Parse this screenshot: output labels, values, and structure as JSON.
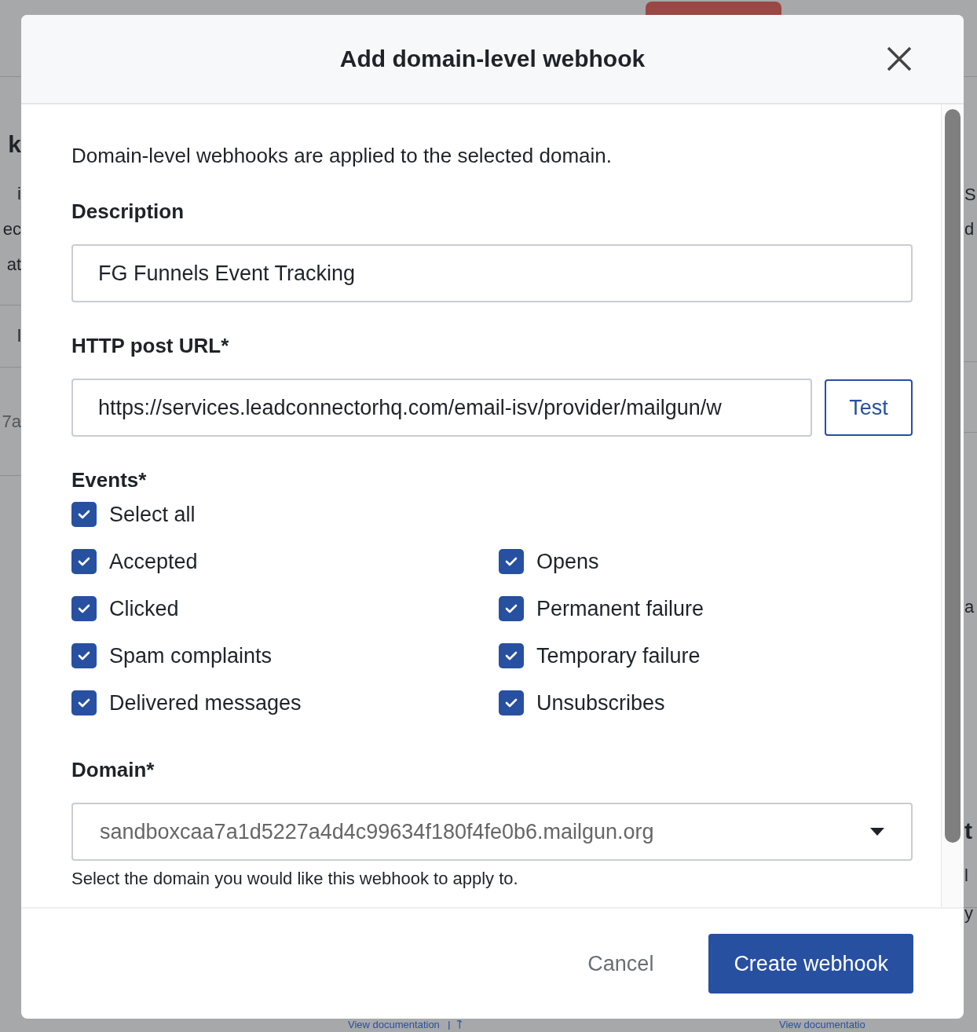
{
  "backdrop": {
    "left_fragments": [
      {
        "text": "k",
        "kind": "heading"
      },
      {
        "text": "i",
        "kind": "text"
      },
      {
        "text": "ec",
        "kind": "text"
      },
      {
        "text": "at",
        "kind": "text"
      },
      {
        "text": "l",
        "kind": "text"
      },
      {
        "text": "7a",
        "kind": "muted"
      }
    ],
    "right_fragments": [
      {
        "text": "S",
        "kind": "text"
      },
      {
        "text": "d",
        "kind": "text"
      },
      {
        "text": "a",
        "kind": "text"
      },
      {
        "text": "t",
        "kind": "heading"
      },
      {
        "text": "l",
        "kind": "text"
      },
      {
        "text": "y",
        "kind": "text"
      }
    ],
    "links": [
      "View documentation",
      "View documentatio"
    ]
  },
  "dialog": {
    "title": "Add domain-level webhook",
    "intro": "Domain-level webhooks are applied to the selected domain.",
    "description": {
      "label": "Description",
      "value": "FG Funnels Event Tracking"
    },
    "url": {
      "label": "HTTP post URL*",
      "value": "https://services.leadconnectorhq.com/email-isv/provider/mailgun/w",
      "test_button": "Test"
    },
    "events": {
      "label": "Events*",
      "select_all": {
        "label": "Select all",
        "checked": true
      },
      "items": [
        {
          "label": "Accepted",
          "checked": true
        },
        {
          "label": "Opens",
          "checked": true
        },
        {
          "label": "Clicked",
          "checked": true
        },
        {
          "label": "Permanent failure",
          "checked": true
        },
        {
          "label": "Spam complaints",
          "checked": true
        },
        {
          "label": "Temporary failure",
          "checked": true
        },
        {
          "label": "Delivered messages",
          "checked": true
        },
        {
          "label": "Unsubscribes",
          "checked": true
        }
      ]
    },
    "domain": {
      "label": "Domain*",
      "value": "sandboxcaa7a1d5227a4d4c99634f180f4fe0b6.mailgun.org",
      "hint": "Select the domain you would like this webhook to apply to."
    },
    "buttons": {
      "cancel": "Cancel",
      "create": "Create webhook"
    }
  }
}
